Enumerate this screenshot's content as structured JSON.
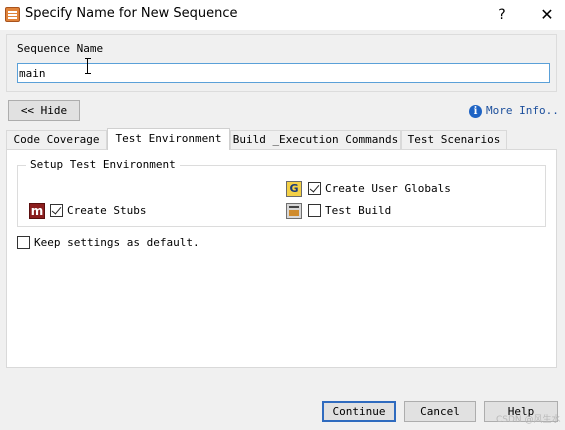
{
  "window": {
    "title": "Specify Name for New Sequence",
    "help_glyph": "?",
    "close_glyph": "✕"
  },
  "sequence_name": {
    "label": "Sequence Name",
    "value": "main"
  },
  "hide_button": "<< Hide",
  "more_info": {
    "icon": "info-icon",
    "icon_glyph": "i",
    "label": "More Info.."
  },
  "tabs": [
    {
      "label": "Code Coverage",
      "active": false
    },
    {
      "label": "Test Environment",
      "active": true
    },
    {
      "label": "Build _Execution Commands",
      "active": false
    },
    {
      "label": "Test Scenarios",
      "active": false
    }
  ],
  "setup_group": {
    "legend": "Setup Test Environment",
    "create_user_globals": {
      "label": "Create User Globals",
      "checked": true,
      "icon": "globals-g-icon",
      "icon_glyph": "G"
    },
    "create_stubs": {
      "label": "Create Stubs",
      "checked": true,
      "icon": "stubs-m-icon",
      "icon_glyph": "m"
    },
    "test_build": {
      "label": "Test Build",
      "checked": false,
      "icon": "build-icon"
    }
  },
  "keep_settings": {
    "label": "Keep settings as default.",
    "checked": false
  },
  "buttons": {
    "continue": "Continue",
    "cancel": "Cancel",
    "help": "Help"
  },
  "watermark": "CSDN @风生水"
}
